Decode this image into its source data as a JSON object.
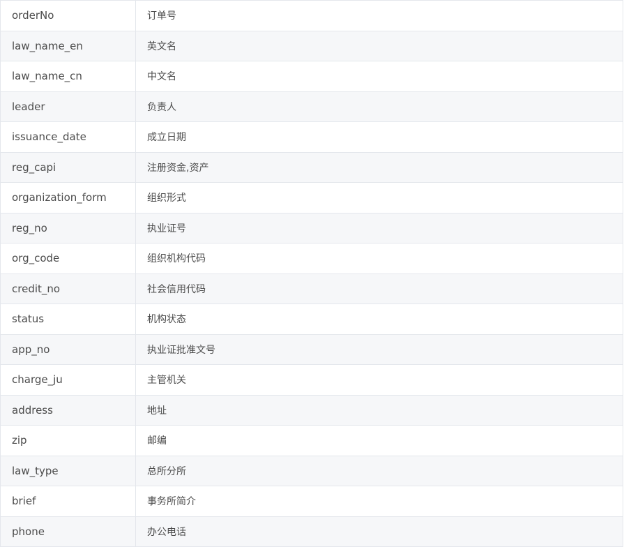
{
  "table": {
    "rows": [
      {
        "field": "orderNo",
        "description": "订单号"
      },
      {
        "field": "law_name_en",
        "description": "英文名"
      },
      {
        "field": "law_name_cn",
        "description": "中文名"
      },
      {
        "field": "leader",
        "description": "负责人"
      },
      {
        "field": "issuance_date",
        "description": "成立日期"
      },
      {
        "field": "reg_capi",
        "description": "注册资金,资产"
      },
      {
        "field": "organization_form",
        "description": "组织形式"
      },
      {
        "field": "reg_no",
        "description": "执业证号"
      },
      {
        "field": "org_code",
        "description": "组织机构代码"
      },
      {
        "field": "credit_no",
        "description": "社会信用代码"
      },
      {
        "field": "status",
        "description": "机构状态"
      },
      {
        "field": "app_no",
        "description": "执业证批准文号"
      },
      {
        "field": "charge_ju",
        "description": "主管机关"
      },
      {
        "field": "address",
        "description": "地址"
      },
      {
        "field": "zip",
        "description": "邮编"
      },
      {
        "field": "law_type",
        "description": "总所分所"
      },
      {
        "field": "brief",
        "description": "事务所简介"
      },
      {
        "field": "phone",
        "description": "办公电话"
      }
    ]
  },
  "colors": {
    "border": "#e4e7ec",
    "stripe": "#f6f7f9",
    "text": "#4b4b4b"
  }
}
